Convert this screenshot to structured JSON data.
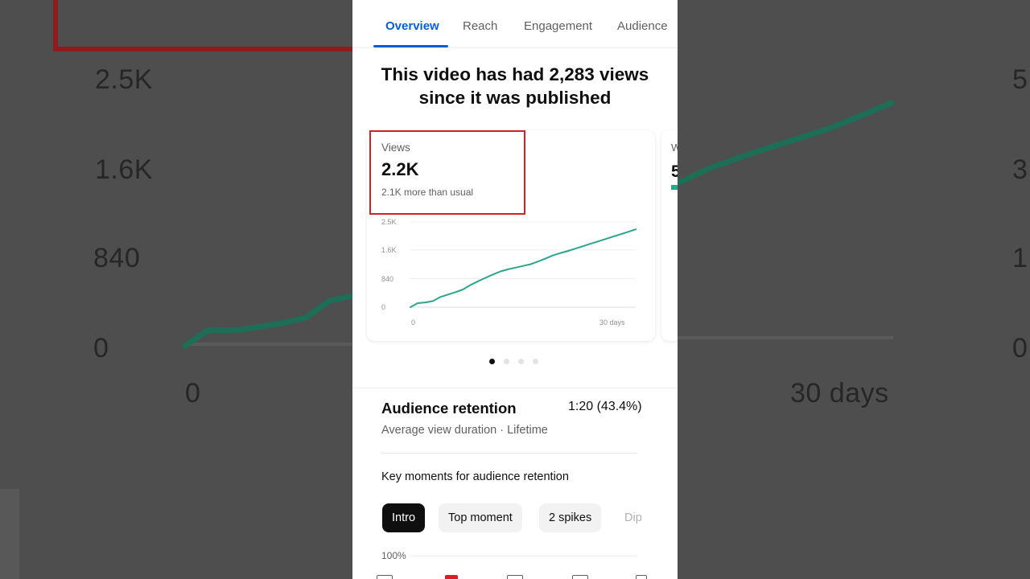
{
  "background": {
    "ticks_left": [
      "2.5K",
      "1.6K",
      "840",
      "0"
    ],
    "ticks_right": [
      "5",
      "3",
      "1",
      "0"
    ],
    "x_start": "0",
    "x_end": "30 days"
  },
  "tabs": [
    {
      "label": "Overview",
      "active": true
    },
    {
      "label": "Reach",
      "active": false
    },
    {
      "label": "Engagement",
      "active": false
    },
    {
      "label": "Audience",
      "active": false
    }
  ],
  "headline": {
    "line1": "This video has had 2,283 views",
    "line2": "since it was published"
  },
  "metric_card": {
    "label": "Views",
    "value": "2.2K",
    "sub": "2.1K more than usual"
  },
  "chart_data": {
    "type": "line",
    "x_labels": [
      "0",
      "30 days"
    ],
    "y_ticks": [
      "2.5K",
      "1.6K",
      "840",
      "0"
    ],
    "ylim": [
      0,
      2500
    ],
    "x": [
      0,
      1,
      2,
      3,
      4,
      5,
      6,
      7,
      8,
      9,
      10,
      11,
      12,
      13,
      14,
      15,
      16,
      17,
      18,
      19,
      20,
      21,
      22,
      23,
      24,
      25,
      26,
      27,
      28,
      29,
      30
    ],
    "values": [
      0,
      120,
      140,
      180,
      300,
      370,
      440,
      520,
      650,
      760,
      860,
      960,
      1050,
      1110,
      1160,
      1210,
      1260,
      1340,
      1430,
      1520,
      1590,
      1650,
      1720,
      1790,
      1860,
      1930,
      2000,
      2070,
      2140,
      2210,
      2283
    ],
    "color": "#2ba58d",
    "grid": true
  },
  "second_card": {
    "label": "W",
    "value": "5"
  },
  "pagination": {
    "count": 4,
    "active": 0
  },
  "retention": {
    "title": "Audience retention",
    "value": "1:20 (43.4%)",
    "sub": "Average view duration · Lifetime"
  },
  "key_moments": {
    "title": "Key moments for audience retention",
    "chips": [
      "Intro",
      "Top moment",
      "2 spikes",
      "Dip"
    ],
    "retention_axis_top": "100%"
  },
  "colors": {
    "accent": "#065fd4",
    "highlight": "#d32026",
    "line": "#2ba58d"
  }
}
